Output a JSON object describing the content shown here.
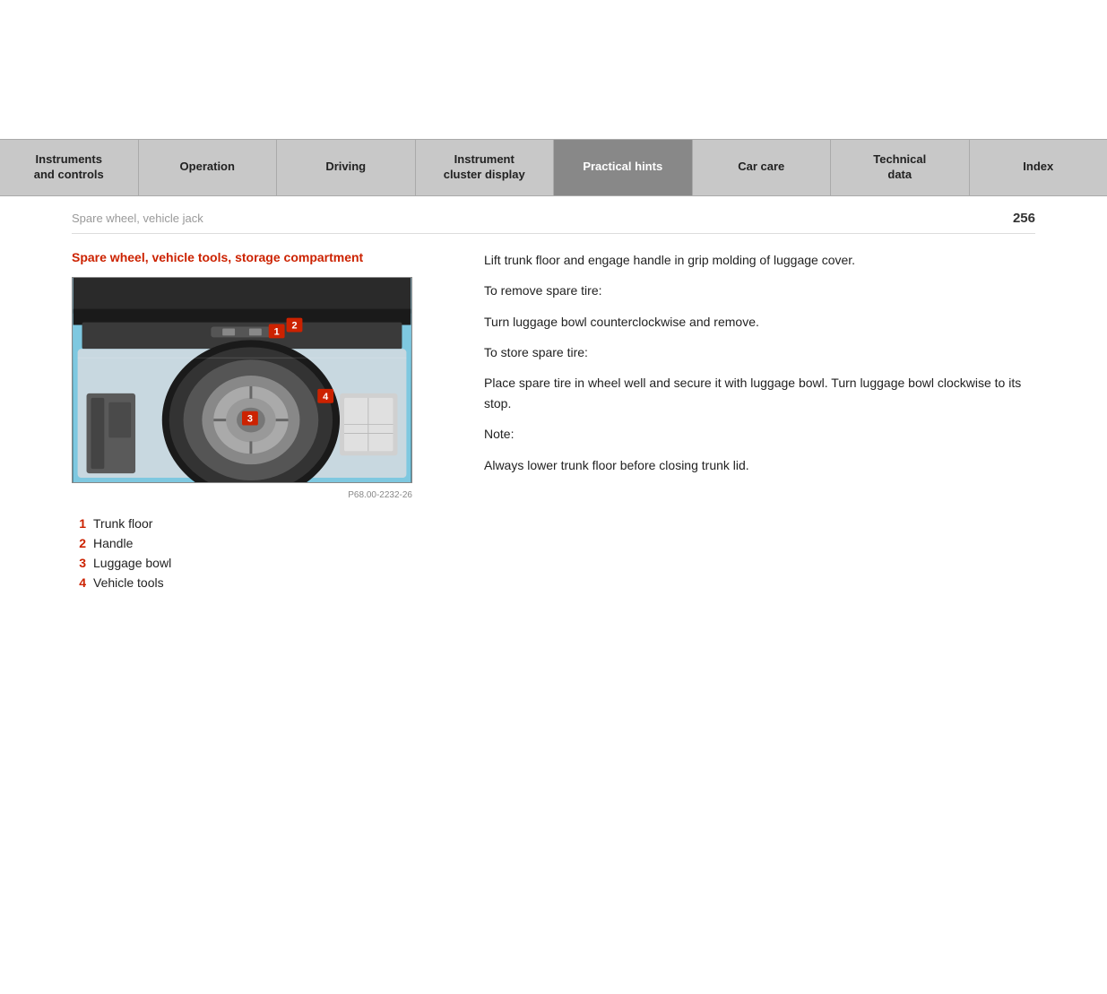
{
  "nav": {
    "items": [
      {
        "id": "instruments",
        "label": "Instruments\nand controls",
        "active": false
      },
      {
        "id": "operation",
        "label": "Operation",
        "active": false
      },
      {
        "id": "driving",
        "label": "Driving",
        "active": false
      },
      {
        "id": "cluster",
        "label": "Instrument\ncluster display",
        "active": false
      },
      {
        "id": "practical",
        "label": "Practical hints",
        "active": true
      },
      {
        "id": "carcare",
        "label": "Car care",
        "active": false
      },
      {
        "id": "technical",
        "label": "Technical\ndata",
        "active": false
      },
      {
        "id": "index",
        "label": "Index",
        "active": false
      }
    ]
  },
  "breadcrumb": "Spare wheel, vehicle jack",
  "page_number": "256",
  "section_title": "Spare wheel, vehicle tools, storage compartment",
  "image_caption": "P68.00-2232-26",
  "numbered_items": [
    {
      "num": "1",
      "text": "Trunk floor"
    },
    {
      "num": "2",
      "text": "Handle"
    },
    {
      "num": "3",
      "text": "Luggage bowl"
    },
    {
      "num": "4",
      "text": "Vehicle tools"
    }
  ],
  "right_col": {
    "para1": "Lift trunk floor and engage handle in grip molding of luggage cover.",
    "para2": "To remove spare tire:",
    "para3": "Turn luggage bowl counterclockwise and remove.",
    "para4": "To store spare tire:",
    "para5": "Place spare tire in wheel well and secure it with luggage bowl. Turn luggage bowl clockwise to its stop.",
    "note_label": "Note:",
    "note_text": "Always lower trunk floor before closing trunk lid."
  }
}
